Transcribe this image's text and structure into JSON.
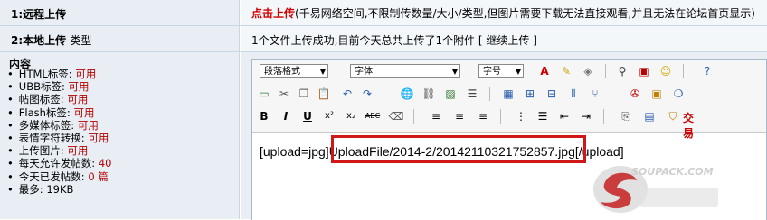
{
  "row1": {
    "label": "1:远程上传",
    "link": "点击上传",
    "desc": "(千易网络空间,不限制传数量/大小/类型,但图片需要下载无法直接观看,并且无法在论坛首页显示)"
  },
  "row2": {
    "label": "2:本地上传",
    "label_sub": "类型",
    "status": "1个文件上传成功,目前今天总共上传了1个附件 [ 继续上传 ]"
  },
  "content": {
    "title": "内容",
    "rules": [
      {
        "label": "HTML标签:",
        "value": "可用"
      },
      {
        "label": "UBB标签:",
        "value": "可用"
      },
      {
        "label": "帖图标签:",
        "value": "可用"
      },
      {
        "label": "Flash标签:",
        "value": "可用"
      },
      {
        "label": "多媒体标签:",
        "value": "可用"
      },
      {
        "label": "表情字符转换:",
        "value": "可用"
      },
      {
        "label": "上传图片:",
        "value": "可用"
      },
      {
        "label": "每天允许发帖数:",
        "value": "40"
      },
      {
        "label": "今天已发帖数:",
        "value": "0 篇"
      },
      {
        "label": "最多:",
        "value": "19KB"
      }
    ]
  },
  "editor": {
    "paragraph_select": "段落格式",
    "font_select": "字体",
    "size_select": "字号",
    "trade_label": "交易",
    "content_prefix": "[upload=jpg]",
    "content_path": "UploadFile/2014-2/20142110321752857.jpg",
    "content_suffix": "[/upload]"
  },
  "watermark": {
    "text": "SOUPACK.COM"
  }
}
